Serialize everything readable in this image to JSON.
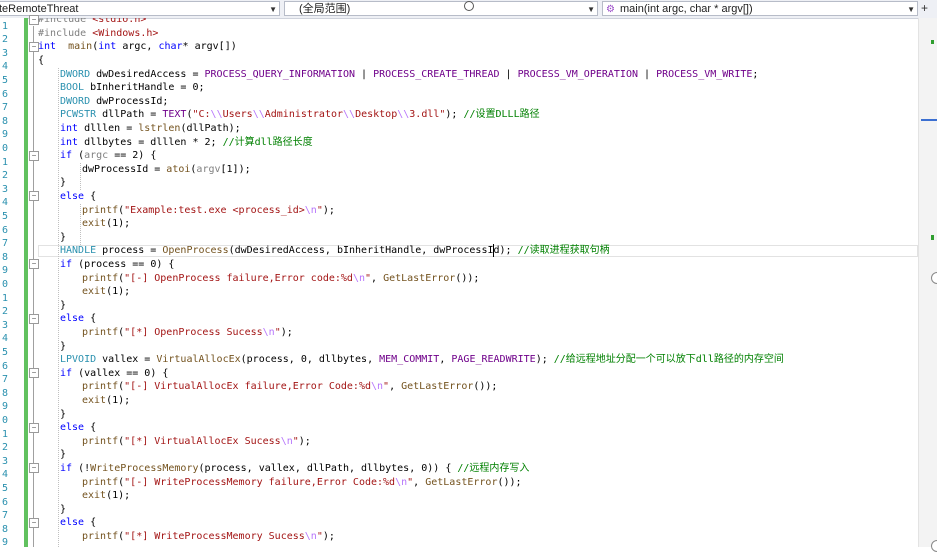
{
  "navbar": {
    "project": "teRemoteThreat",
    "scope": "(全局范围)",
    "function": "main(int argc, char * argv[])",
    "plus_icon": "+",
    "function_icon": "cube-icon"
  },
  "line_numbers": [
    "1",
    "2",
    "3",
    "4",
    "5",
    "6",
    "7",
    "8",
    "9",
    "0",
    "1",
    "2",
    "3",
    "4",
    "5",
    "6",
    "7",
    "8",
    "9",
    "0",
    "1",
    "2",
    "3",
    "4",
    "5",
    "6",
    "7",
    "8",
    "9",
    "0",
    "1",
    "2",
    "3",
    "4",
    "5",
    "6",
    "7",
    "8",
    "9",
    "0"
  ],
  "code_lines": [
    {
      "indent": 0,
      "fold": "minus",
      "tokens": [
        [
          "pp",
          "#include "
        ],
        [
          "str",
          "<stdio.h>"
        ]
      ]
    },
    {
      "indent": 0,
      "tokens": [
        [
          "pp",
          "#include "
        ],
        [
          "str",
          "<Windows.h>"
        ]
      ]
    },
    {
      "indent": 0,
      "fold": "minus",
      "tokens": [
        [
          "kw",
          "int"
        ],
        [
          "",
          "  "
        ],
        [
          "fn",
          "main"
        ],
        [
          "",
          "("
        ],
        [
          "kw",
          "int"
        ],
        [
          "",
          " argc, "
        ],
        [
          "kw",
          "char"
        ],
        [
          "",
          "* argv[])"
        ]
      ]
    },
    {
      "indent": 0,
      "tokens": [
        [
          "",
          "{"
        ]
      ]
    },
    {
      "indent": 1,
      "tokens": [
        [
          "ty",
          "DWORD"
        ],
        [
          "",
          " dwDesiredAccess = "
        ],
        [
          "mac",
          "PROCESS_QUERY_INFORMATION"
        ],
        [
          "",
          " | "
        ],
        [
          "mac",
          "PROCESS_CREATE_THREAD"
        ],
        [
          "",
          " | "
        ],
        [
          "mac",
          "PROCESS_VM_OPERATION"
        ],
        [
          "",
          " | "
        ],
        [
          "mac",
          "PROCESS_VM_WRITE"
        ],
        [
          "",
          ";"
        ]
      ]
    },
    {
      "indent": 1,
      "tokens": [
        [
          "ty",
          "BOOL"
        ],
        [
          "",
          " bInheritHandle = 0;"
        ]
      ]
    },
    {
      "indent": 1,
      "tokens": [
        [
          "ty",
          "DWORD"
        ],
        [
          "",
          " dwProcessId;"
        ]
      ]
    },
    {
      "indent": 1,
      "tokens": [
        [
          "ty",
          "PCWSTR"
        ],
        [
          "",
          " dllPath = "
        ],
        [
          "mac",
          "TEXT"
        ],
        [
          "",
          "("
        ],
        [
          "str",
          "\"C:"
        ],
        [
          "esc",
          "\\\\"
        ],
        [
          "str",
          "Users"
        ],
        [
          "esc",
          "\\\\"
        ],
        [
          "str",
          "Administrator"
        ],
        [
          "esc",
          "\\\\"
        ],
        [
          "str",
          "Desktop"
        ],
        [
          "esc",
          "\\\\"
        ],
        [
          "str",
          "3.dll\""
        ],
        [
          "",
          "); "
        ],
        [
          "cm",
          "//设置DLLL路径"
        ]
      ]
    },
    {
      "indent": 1,
      "tokens": [
        [
          "kw",
          "int"
        ],
        [
          "",
          " dlllen = "
        ],
        [
          "fn",
          "lstrlen"
        ],
        [
          "",
          "(dllPath);"
        ]
      ]
    },
    {
      "indent": 1,
      "tokens": [
        [
          "kw",
          "int"
        ],
        [
          "",
          " dllbytes = dlllen * 2; "
        ],
        [
          "cm",
          "//计算dll路径长度"
        ]
      ]
    },
    {
      "indent": 1,
      "fold": "minus",
      "tokens": [
        [
          "kw",
          "if"
        ],
        [
          "",
          " ("
        ],
        [
          "pp",
          "argc"
        ],
        [
          "",
          " == 2) {"
        ]
      ]
    },
    {
      "indent": 2,
      "tokens": [
        [
          "",
          "dwProcessId = "
        ],
        [
          "fn",
          "atoi"
        ],
        [
          "",
          "("
        ],
        [
          "pp",
          "argv"
        ],
        [
          "",
          "[1]);"
        ]
      ]
    },
    {
      "indent": 1,
      "tokens": [
        [
          "",
          "}"
        ]
      ]
    },
    {
      "indent": 1,
      "fold": "minus",
      "tokens": [
        [
          "kw",
          "else"
        ],
        [
          "",
          " {"
        ]
      ]
    },
    {
      "indent": 2,
      "tokens": [
        [
          "fn",
          "printf"
        ],
        [
          "",
          "("
        ],
        [
          "str",
          "\"Example:test.exe <process_id>"
        ],
        [
          "esc",
          "\\n"
        ],
        [
          "str",
          "\""
        ],
        [
          "",
          ");"
        ]
      ]
    },
    {
      "indent": 2,
      "tokens": [
        [
          "fn",
          "exit"
        ],
        [
          "",
          "(1);"
        ]
      ]
    },
    {
      "indent": 1,
      "tokens": [
        [
          "",
          "}"
        ]
      ]
    },
    {
      "indent": 1,
      "current": true,
      "tokens": [
        [
          "ty",
          "HANDLE"
        ],
        [
          "",
          " process = "
        ],
        [
          "fn",
          "OpenProcess"
        ],
        [
          "",
          "(dwDesiredAccess, bInheritHandle, dwProcessId); "
        ],
        [
          "cm",
          "//读取进程获取句柄"
        ]
      ]
    },
    {
      "indent": 1,
      "fold": "minus",
      "tokens": [
        [
          "kw",
          "if"
        ],
        [
          "",
          " (process == 0) {"
        ]
      ]
    },
    {
      "indent": 2,
      "tokens": [
        [
          "fn",
          "printf"
        ],
        [
          "",
          "("
        ],
        [
          "str",
          "\"[-] OpenProcess failure,Error code:%d"
        ],
        [
          "esc",
          "\\n"
        ],
        [
          "str",
          "\""
        ],
        [
          "",
          ", "
        ],
        [
          "fn",
          "GetLastError"
        ],
        [
          "",
          "());"
        ]
      ]
    },
    {
      "indent": 2,
      "tokens": [
        [
          "fn",
          "exit"
        ],
        [
          "",
          "(1);"
        ]
      ]
    },
    {
      "indent": 1,
      "tokens": [
        [
          "",
          "}"
        ]
      ]
    },
    {
      "indent": 1,
      "fold": "minus",
      "tokens": [
        [
          "kw",
          "else"
        ],
        [
          "",
          " {"
        ]
      ]
    },
    {
      "indent": 2,
      "tokens": [
        [
          "fn",
          "printf"
        ],
        [
          "",
          "("
        ],
        [
          "str",
          "\"[*] OpenProcess Sucess"
        ],
        [
          "esc",
          "\\n"
        ],
        [
          "str",
          "\""
        ],
        [
          "",
          ");"
        ]
      ]
    },
    {
      "indent": 1,
      "tokens": [
        [
          "",
          "}"
        ]
      ]
    },
    {
      "indent": 1,
      "tokens": [
        [
          "ty",
          "LPVOID"
        ],
        [
          "",
          " vallex = "
        ],
        [
          "fn",
          "VirtualAllocEx"
        ],
        [
          "",
          "(process, 0, dllbytes, "
        ],
        [
          "mac",
          "MEM_COMMIT"
        ],
        [
          "",
          ", "
        ],
        [
          "mac",
          "PAGE_READWRITE"
        ],
        [
          "",
          "); "
        ],
        [
          "cm",
          "//给远程地址分配一个可以放下dll路径的内存空间"
        ]
      ]
    },
    {
      "indent": 1,
      "fold": "minus",
      "tokens": [
        [
          "kw",
          "if"
        ],
        [
          "",
          " (vallex == 0) {"
        ]
      ]
    },
    {
      "indent": 2,
      "tokens": [
        [
          "fn",
          "printf"
        ],
        [
          "",
          "("
        ],
        [
          "str",
          "\"[-] VirtualAllocEx failure,Error Code:%d"
        ],
        [
          "esc",
          "\\n"
        ],
        [
          "str",
          "\""
        ],
        [
          "",
          ", "
        ],
        [
          "fn",
          "GetLastError"
        ],
        [
          "",
          "());"
        ]
      ]
    },
    {
      "indent": 2,
      "tokens": [
        [
          "fn",
          "exit"
        ],
        [
          "",
          "(1);"
        ]
      ]
    },
    {
      "indent": 1,
      "tokens": [
        [
          "",
          "}"
        ]
      ]
    },
    {
      "indent": 1,
      "fold": "minus",
      "tokens": [
        [
          "kw",
          "else"
        ],
        [
          "",
          " {"
        ]
      ]
    },
    {
      "indent": 2,
      "tokens": [
        [
          "fn",
          "printf"
        ],
        [
          "",
          "("
        ],
        [
          "str",
          "\"[*] VirtualAllocEx Sucess"
        ],
        [
          "esc",
          "\\n"
        ],
        [
          "str",
          "\""
        ],
        [
          "",
          ");"
        ]
      ]
    },
    {
      "indent": 1,
      "tokens": [
        [
          "",
          "}"
        ]
      ]
    },
    {
      "indent": 1,
      "fold": "minus",
      "tokens": [
        [
          "kw",
          "if"
        ],
        [
          "",
          " (!"
        ],
        [
          "fn",
          "WriteProcessMemory"
        ],
        [
          "",
          "(process, vallex, dllPath, dllbytes, 0)) { "
        ],
        [
          "cm",
          "//远程内存写入"
        ]
      ]
    },
    {
      "indent": 2,
      "tokens": [
        [
          "fn",
          "printf"
        ],
        [
          "",
          "("
        ],
        [
          "str",
          "\"[-] WriteProcessMemory failure,Error Code:%d"
        ],
        [
          "esc",
          "\\n"
        ],
        [
          "str",
          "\""
        ],
        [
          "",
          ", "
        ],
        [
          "fn",
          "GetLastError"
        ],
        [
          "",
          "());"
        ]
      ]
    },
    {
      "indent": 2,
      "tokens": [
        [
          "fn",
          "exit"
        ],
        [
          "",
          "(1);"
        ]
      ]
    },
    {
      "indent": 1,
      "tokens": [
        [
          "",
          "}"
        ]
      ]
    },
    {
      "indent": 1,
      "fold": "minus",
      "tokens": [
        [
          "kw",
          "else"
        ],
        [
          "",
          " {"
        ]
      ]
    },
    {
      "indent": 2,
      "tokens": [
        [
          "fn",
          "printf"
        ],
        [
          "",
          "("
        ],
        [
          "str",
          "\"[*] WriteProcessMemory Sucess"
        ],
        [
          "esc",
          "\\n"
        ],
        [
          "str",
          "\""
        ],
        [
          "",
          ");"
        ]
      ]
    }
  ],
  "colors": {
    "keyword": "#0000ff",
    "type": "#2b91af",
    "function": "#74531f",
    "macro": "#6f008a",
    "string": "#a31515",
    "comment": "#008000",
    "preprocessor": "#808080",
    "escape": "#b776fb",
    "changes_bar": "#61c15f",
    "line_number": "#2b91af"
  }
}
